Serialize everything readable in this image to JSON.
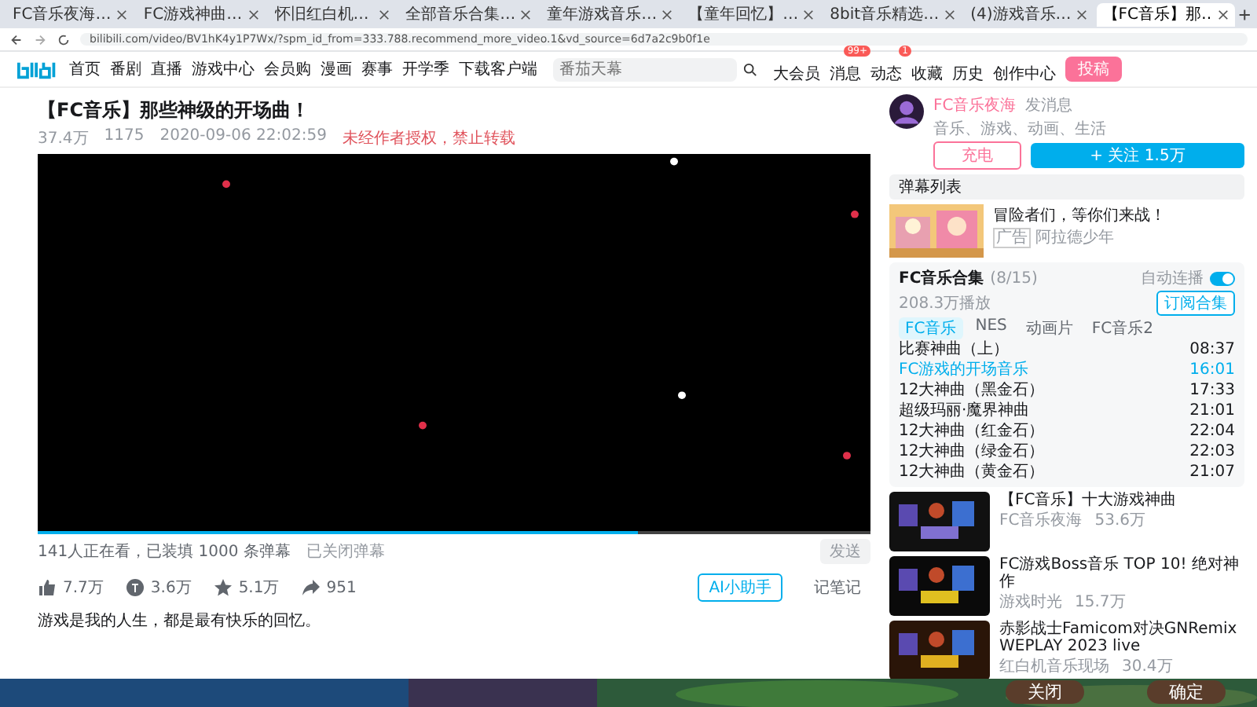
{
  "browser": {
    "tabs": [
      {
        "title": "FC音乐夜海…",
        "selected": false
      },
      {
        "title": "FC游戏神曲…",
        "selected": false
      },
      {
        "title": "怀旧红白机…",
        "selected": false
      },
      {
        "title": "全部音乐合集…",
        "selected": false
      },
      {
        "title": "童年游戏音乐…",
        "selected": false
      },
      {
        "title": "【童年回忆】…",
        "selected": false
      },
      {
        "title": "8bit音乐精选…",
        "selected": false
      },
      {
        "title": "(4)游戏音乐…",
        "selected": false
      },
      {
        "title": "【FC音乐】那…",
        "selected": true
      }
    ],
    "url": "bilibili.com/video/BV1hK4y1P7Wx/?spm_id_from=333.788.recommend_more_video.1&vd_source=6d7a2c9b0f1e"
  },
  "nav": {
    "items": [
      "首页",
      "番剧",
      "直播",
      "游戏中心",
      "会员购",
      "漫画",
      "赛事",
      "开学季",
      "下载客户端"
    ],
    "search": {
      "placeholder": "番茄天幕"
    },
    "icons": [
      {
        "label": "大会员"
      },
      {
        "label": "消息",
        "badge": "99+"
      },
      {
        "label": "动态",
        "badge": "1"
      },
      {
        "label": "收藏"
      },
      {
        "label": "历史"
      },
      {
        "label": "创作中心"
      }
    ],
    "upload": "投稿"
  },
  "video": {
    "title": "【FC音乐】那些神级的开场曲！",
    "views": "37.4万",
    "danmaku": "1175",
    "date": "2020-09-06 22:02:59",
    "notice": "未经作者授权，禁止转载",
    "progress": {
      "level": 0.72
    },
    "watching": "141人正在看，已装填 1000 条弹幕",
    "danmaku_state": "已关闭弹幕",
    "send": "发送",
    "actions": [
      {
        "kind": "like",
        "count": "7.7万"
      },
      {
        "kind": "coin",
        "count": "3.6万"
      },
      {
        "kind": "star",
        "count": "5.1万"
      },
      {
        "kind": "share",
        "count": "951"
      }
    ],
    "assistant": "AI小助手",
    "note": "记笔记",
    "description": "游戏是我的人生，都是最有快乐的回忆。"
  },
  "uploader": {
    "name": "FC音乐夜海",
    "message": "发消息",
    "bio": "音乐、游戏、动画、生活",
    "charge": "充电",
    "follow": "+ 关注 1.5万"
  },
  "danmaku_list": {
    "title": "弹幕列表"
  },
  "ad": {
    "title": "冒险者们，等你们来战！",
    "tag": "广告",
    "source": "阿拉德少年"
  },
  "playlist": {
    "title": "FC音乐合集",
    "position": "(8/15)",
    "autoplay_label": "自动连播",
    "autoplay": true,
    "plays": "208.3万播放",
    "subscribe": "订阅合集",
    "tabs": [
      {
        "label": "FC音乐",
        "selected": true
      },
      {
        "label": "NES",
        "selected": false
      },
      {
        "label": "动画片",
        "selected": false
      },
      {
        "label": "FC音乐2",
        "selected": false
      }
    ],
    "items": [
      {
        "title": "比赛神曲（上）",
        "time": "08:37",
        "selected": false
      },
      {
        "title": "FC游戏的开场音乐",
        "time": "16:01",
        "selected": true
      },
      {
        "title": "12大神曲（黑金石）",
        "time": "17:33",
        "selected": false
      },
      {
        "title": "超级玛丽·魔界神曲",
        "time": "21:01",
        "selected": false
      },
      {
        "title": "12大神曲（红金石）",
        "time": "22:04",
        "selected": false
      },
      {
        "title": "12大神曲（绿金石）",
        "time": "22:03",
        "selected": false
      },
      {
        "title": "12大神曲（黄金石）",
        "time": "21:07",
        "selected": false
      }
    ]
  },
  "recommendations": [
    {
      "title": "【FC音乐】十大游戏神曲",
      "author": "FC音乐夜海",
      "plays": "53.6万"
    },
    {
      "title": "FC游戏Boss音乐 TOP 10! 绝对神作",
      "author": "游戏时光",
      "plays": "15.7万"
    },
    {
      "title": "赤影战士Famicom对决GNRemix WEPLAY 2023 live",
      "author": "红白机音乐现场",
      "plays": "30.4万"
    }
  ],
  "dialog": {
    "buttons": [
      "关闭",
      "确定"
    ]
  }
}
